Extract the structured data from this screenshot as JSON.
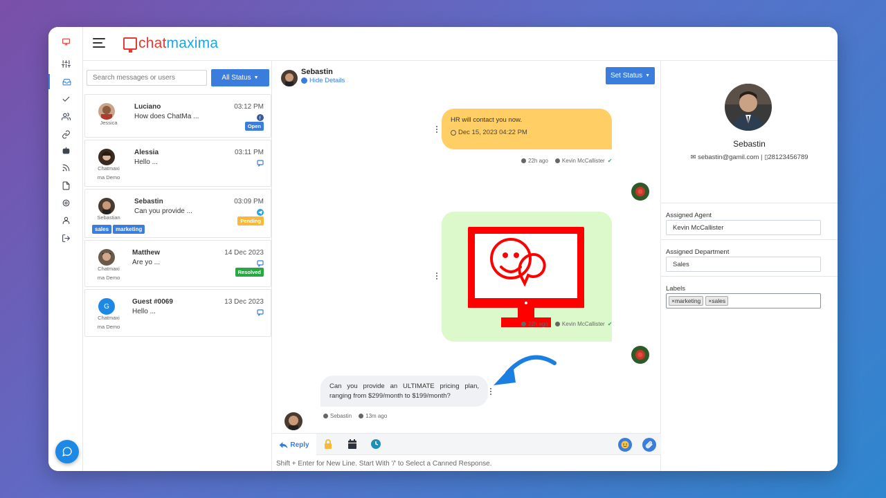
{
  "brand": {
    "part1": "chat",
    "part2": "maxima"
  },
  "search": {
    "placeholder": "Search messages or users"
  },
  "filter": {
    "label": "All Status"
  },
  "conversations": [
    {
      "name": "Luciano",
      "sub": "Jessica",
      "preview": "How does ChatMa ...",
      "time": "03:12 PM",
      "channel": "facebook",
      "status": "Open",
      "status_color": "#3b7ddd"
    },
    {
      "name": "Alessia",
      "sub": "Chatmaxi ma Demo",
      "preview": "Hello ...",
      "time": "03:11 PM",
      "channel": "chat",
      "status": "",
      "status_color": ""
    },
    {
      "name": "Sebastin",
      "sub": "Sebastian",
      "preview": "Can you provide ...",
      "time": "03:09 PM",
      "channel": "telegram",
      "status": "Pending",
      "status_color": "#f6b93b",
      "tags": [
        "sales",
        "marketing"
      ]
    },
    {
      "name": "Matthew",
      "sub": "Chatmaxi ma Demo",
      "preview": "Are yo ...",
      "time": "14 Dec 2023",
      "channel": "chat",
      "status": "Resolved",
      "status_color": "#28a745"
    },
    {
      "name": "Guest #0069",
      "sub": "Chatmaxi ma Demo",
      "preview": "Hello ...",
      "time": "13 Dec 2023",
      "channel": "chat",
      "status": "",
      "status_color": "",
      "initial": "G"
    }
  ],
  "chat": {
    "contact_name": "Sebastin",
    "hide_details": "Hide Details",
    "set_status": "Set Status",
    "messages": [
      {
        "type": "text-out",
        "text": "HR will contact you now.",
        "date": "Dec 15, 2023 04:22 PM",
        "ago": "22h ago",
        "agent": "Kevin McCallister"
      },
      {
        "type": "image-out",
        "ago": "22h ago",
        "agent": "Kevin McCallister"
      },
      {
        "type": "text-in",
        "text": "Can you provide an ULTIMATE pricing plan, ranging from $299/month to $199/month?",
        "sender": "Sebastin",
        "ago": "13m ago"
      }
    ],
    "reply_tab": "Reply",
    "composer_placeholder": "Shift + Enter for New Line. Start With '/' to Select a Canned Response."
  },
  "details": {
    "name": "Sebastin",
    "email": "sebastin@gamil.com",
    "phone": "28123456789",
    "assigned_agent_label": "Assigned Agent",
    "assigned_agent": "Kevin McCallister",
    "assigned_department_label": "Assigned Department",
    "assigned_department": "Sales",
    "labels_label": "Labels",
    "labels": [
      "marketing",
      "sales"
    ]
  },
  "colors": {
    "accent": "#3b7ddd",
    "brand_red": "#e53935",
    "brand_blue": "#1ba6e0",
    "bubble_out": "#ffcf66",
    "bubble_image": "#dcf9cb",
    "bubble_in": "#f0f1f4"
  }
}
